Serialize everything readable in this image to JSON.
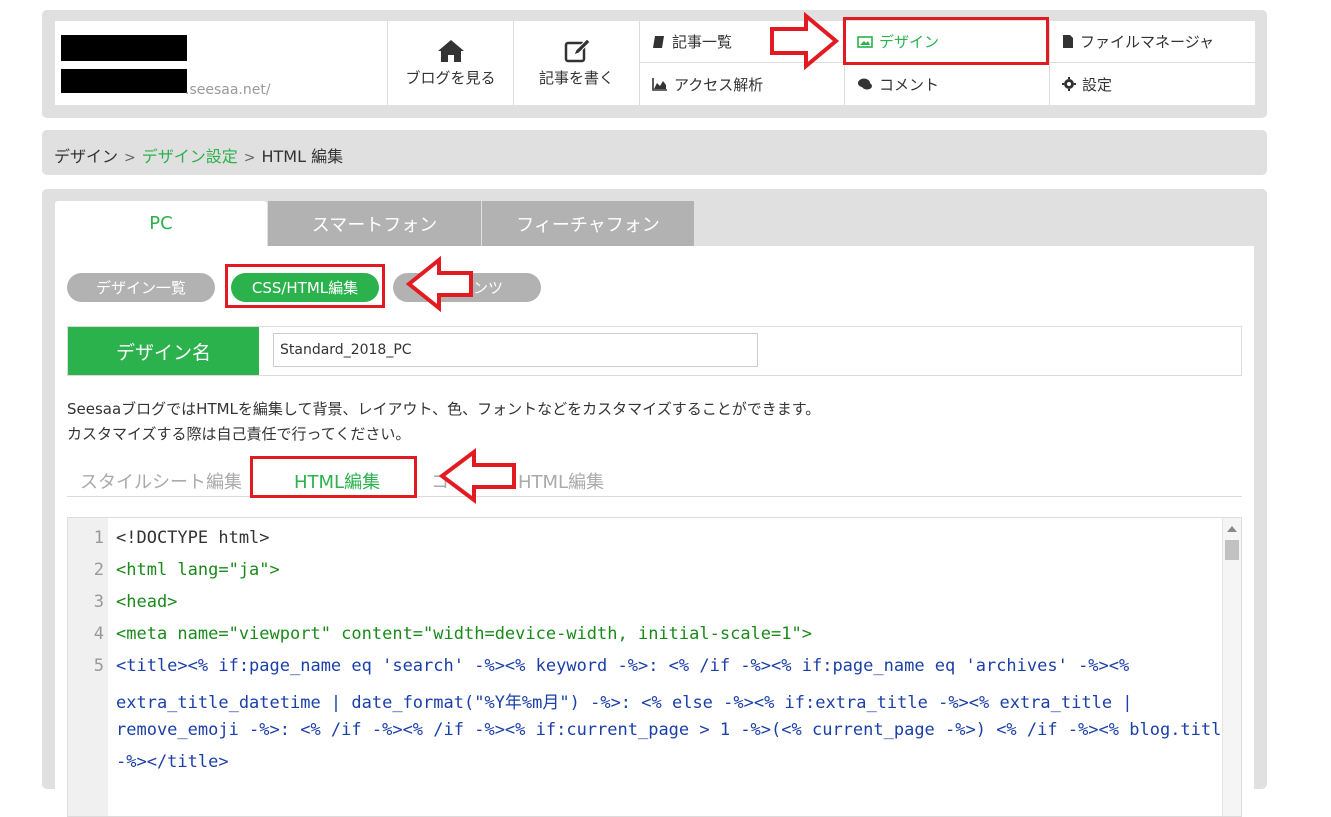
{
  "header": {
    "domain": ".seesaa.net/",
    "view_blog": "ブログを見る",
    "write_post": "記事を書く",
    "nav": {
      "articles": "記事一覧",
      "design": "デザイン",
      "files": "ファイルマネージャ",
      "access": "アクセス解析",
      "comments": "コメント",
      "settings": "設定"
    }
  },
  "breadcrumb": {
    "items": [
      "デザイン",
      "デザイン設定",
      "HTML 編集"
    ],
    "separator": ">"
  },
  "platform_tabs": [
    "PC",
    "スマートフォン",
    "フィーチャフォン"
  ],
  "mode_tabs": [
    "デザイン一覧",
    "CSS/HTML編集",
    "ンツ"
  ],
  "design_name": {
    "label": "デザイン名",
    "value": "Standard_2018_PC"
  },
  "description": {
    "line1": "SeesaaブログではHTMLを編集して背景、レイアウト、色、フォントなどをカスタマイズすることができます。",
    "line2": "カスタマイズする際は自己責任で行ってください。"
  },
  "sub_tabs": [
    "スタイルシート編集",
    "HTML編集",
    "コ",
    "HTML編集"
  ],
  "editor": {
    "line_numbers": [
      "1",
      "2",
      "3",
      "4",
      "5"
    ],
    "lines": [
      "<!DOCTYPE html>",
      "<html lang=\"ja\">",
      "<head>",
      "<meta name=\"viewport\" content=\"width=device-width, initial-scale=1\">",
      "<title><% if:page_name eq 'search' -%><% keyword -%>: <% /if -%><% if:page_name eq 'archives' -%><%",
      "extra_title_datetime | date_format(\"%Y年%m月\") -%>: <% else -%><% if:extra_title -%><% extra_title |",
      "remove_emoji -%>: <% /if -%><% /if -%><% if:current_page > 1 -%>(<% current_page -%>) <% /if -%><% blog.title",
      "-%></title>"
    ]
  },
  "colors": {
    "accent": "#2bb24c",
    "annotation": "#e21b23",
    "tab_inactive": "#b2b2b2"
  },
  "icons": [
    "home-icon",
    "edit-icon",
    "book-icon",
    "image-icon",
    "file-icon",
    "chart-icon",
    "comment-icon",
    "gear-icon",
    "arrow-annotation"
  ]
}
